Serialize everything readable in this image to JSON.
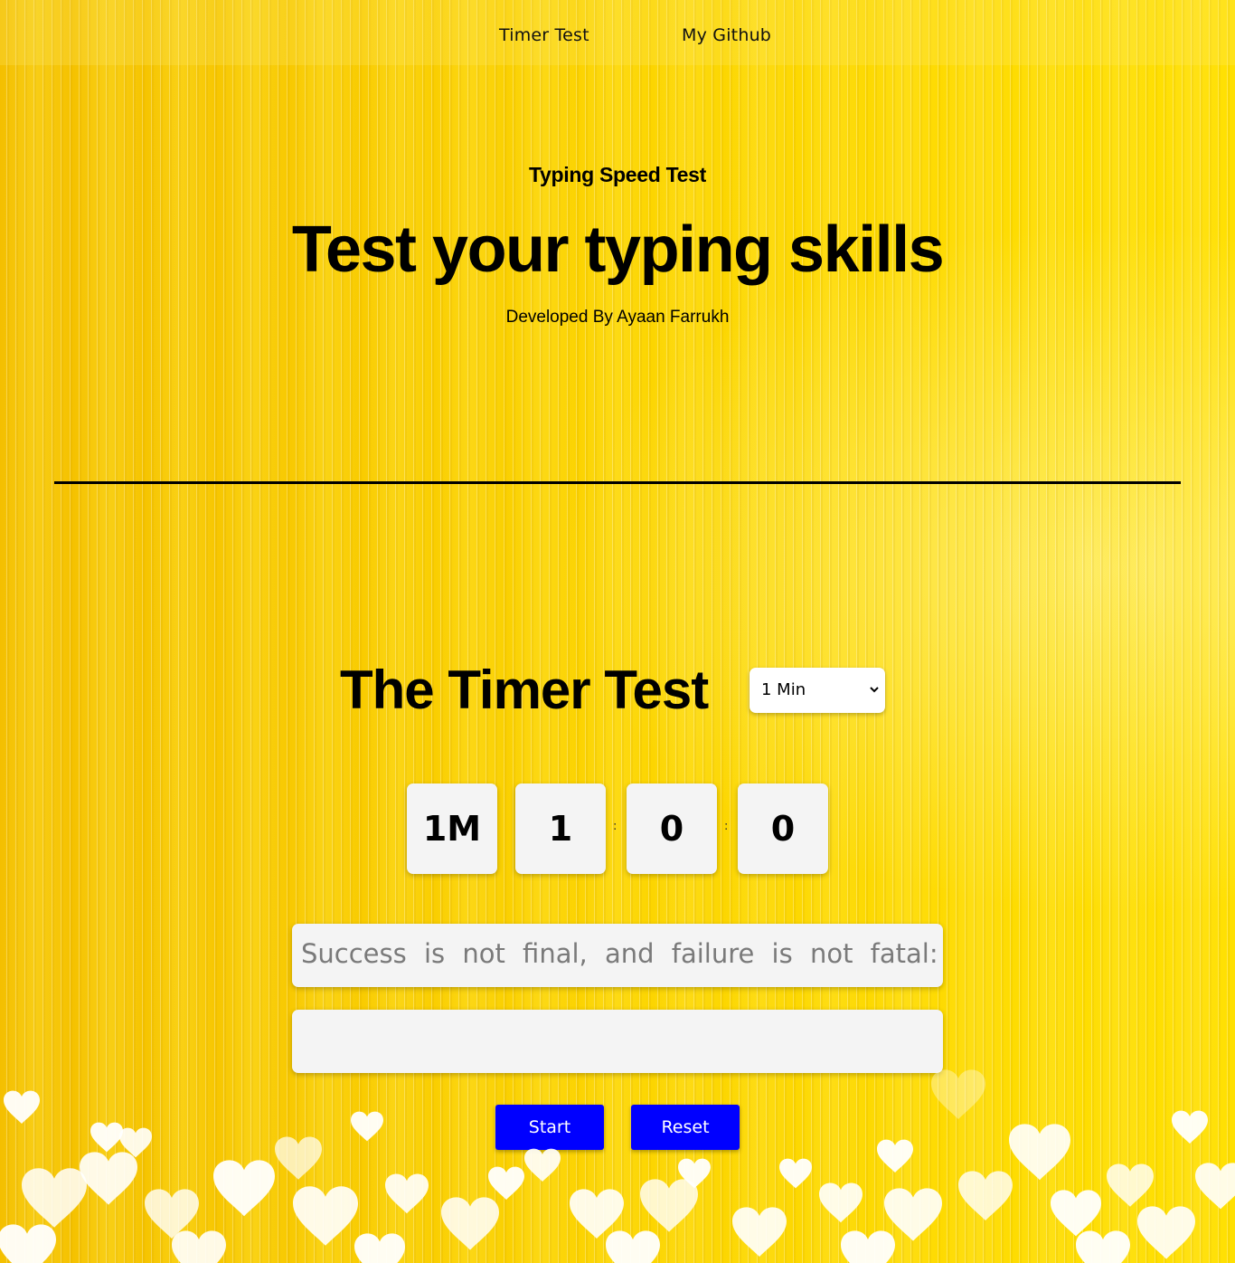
{
  "nav": {
    "items": [
      {
        "label": "Timer Test"
      },
      {
        "label": "My Github"
      }
    ]
  },
  "hero": {
    "kicker": "Typing Speed Test",
    "title": "Test your typing skills",
    "credit": "Developed By Ayaan Farrukh"
  },
  "timer": {
    "title": "The Timer Test",
    "duration_selected": "1 Min",
    "display": [
      "1M",
      "1",
      "0",
      "0"
    ],
    "separator": ":"
  },
  "quote": {
    "text": "Success is not final, and failure is not fatal: it"
  },
  "typing": {
    "value": "",
    "placeholder": ""
  },
  "buttons": {
    "start": "Start",
    "reset": "Reset"
  },
  "colors": {
    "background": "#f7c800",
    "button": "#0000ff",
    "box": "#f4f4f4"
  }
}
